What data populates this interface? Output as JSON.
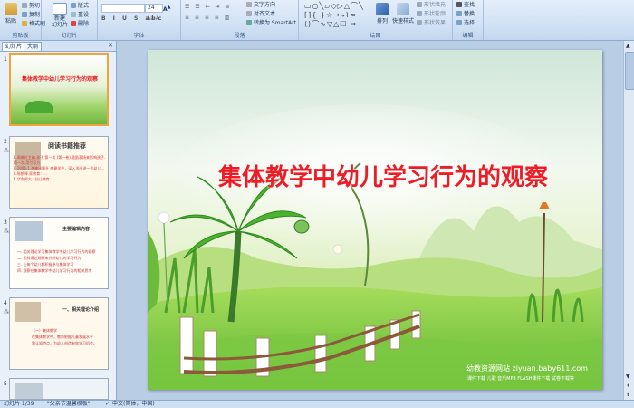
{
  "ribbon": {
    "clipboard": {
      "label": "剪贴板",
      "paste": "粘贴",
      "cut": "剪切",
      "copy": "复制",
      "format_painter": "格式刷"
    },
    "slides": {
      "label": "幻灯片",
      "new_slide": "新建\n幻灯片",
      "layout": "版式",
      "reset": "重设",
      "delete": "删除"
    },
    "font": {
      "label": "字体",
      "size": "24"
    },
    "paragraph": {
      "label": "段落",
      "text_direction": "文字方向",
      "align_text": "对齐文本",
      "smartart": "转换为 SmartArt"
    },
    "drawing": {
      "label": "绘图",
      "arrange": "排列",
      "quick_styles": "快速样式",
      "shape_fill": "形状填充",
      "shape_outline": "形状轮廓",
      "shape_effects": "形状效果"
    },
    "editing": {
      "label": "编辑",
      "find": "查找",
      "replace": "替换",
      "select": "选择"
    }
  },
  "panel": {
    "tab_slides": "幻灯片",
    "tab_outline": "大纲",
    "thumbs": [
      {
        "num": "1",
        "title": "集体教学中幼儿学习行为的观察"
      },
      {
        "num": "2",
        "title": "阅读书籍推荐",
        "lines": [
          "1.周晓红主编.孩子 第一次 (第一卷),鼓励表扬来影响孩子.第一次,用引导方",
          "2.2006.1.海峡出版社 感谢关注，深入浅出讲一位幼儿...",
          "3.陈鹤琴.家教育：...",
          "4.华东师大...幼儿教育"
        ]
      },
      {
        "num": "3",
        "title": "主要编辑内容",
        "lines": [
          "一. 相关理论学习集体教学中幼儿学习行为的观察",
          "二. 怎样通过观察来分析幼儿的学习行为",
          "三. 让每个幼儿都积极参与集体学习",
          "四. 观察在集体教学中幼儿学习行为的相关思考"
        ]
      },
      {
        "num": "4",
        "title": "一、相关理论介绍",
        "lines": [
          "（一）集体教学",
          "在集体教学中，教师根据儿童发展水平",
          "和认知特点，为幼儿创造有效学习机会。"
        ]
      },
      {
        "num": "5"
      }
    ]
  },
  "slide": {
    "title": "集体教学中幼儿学习行为的观察",
    "site": "幼教资源网站  ziyuan.baby611.com",
    "sub": "课件下载  儿歌  音乐MP3  FLASH课件下载  试卷下载等"
  },
  "status": {
    "slide_info": "幻灯片 1/39",
    "theme": "\"父亲节温馨模板\"",
    "language": "中文(简体，中国)"
  },
  "colors": {
    "title_red": "#ee1c25",
    "ribbon_bg": "#dbe7f6",
    "selection": "#f2a33a"
  }
}
